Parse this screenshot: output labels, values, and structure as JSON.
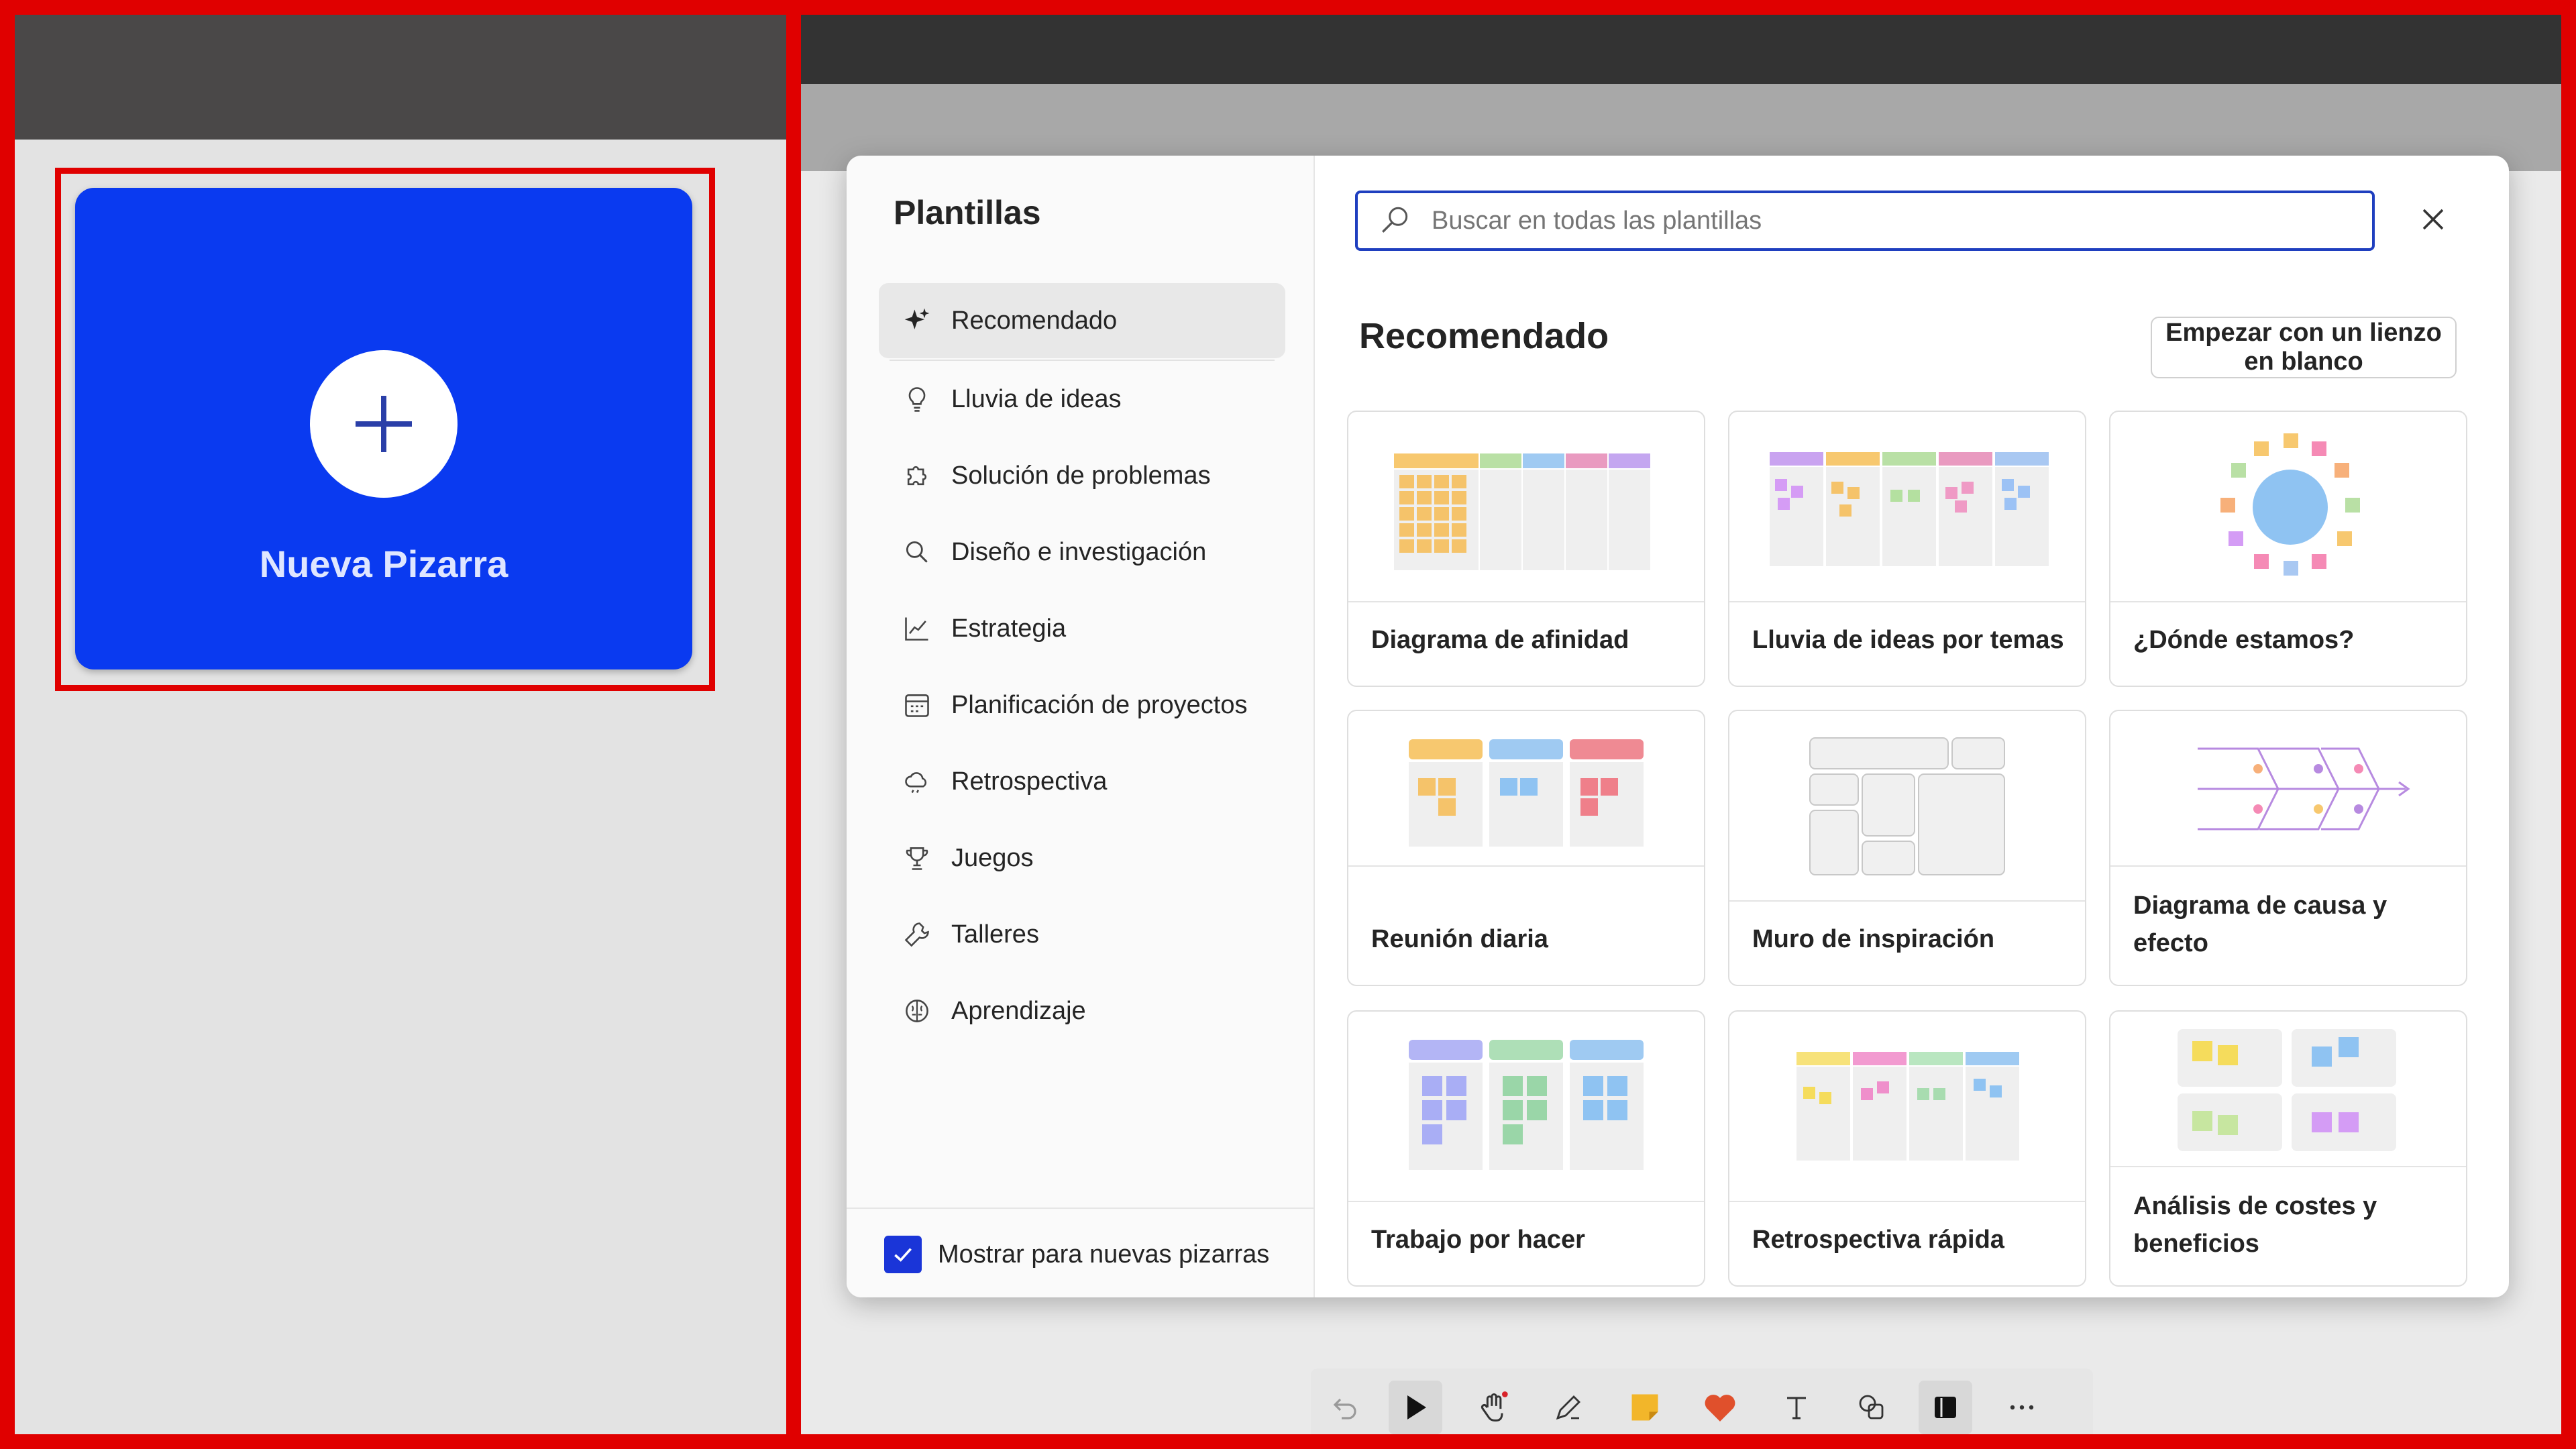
{
  "left": {
    "new_board_label": "Nueva Pizarra"
  },
  "dialog": {
    "title": "Plantillas",
    "search_placeholder": "Buscar en todas las plantillas",
    "section_title": "Recomendado",
    "blank_button": "Empezar con un lienzo en blanco",
    "show_checkbox_label": "Mostrar para nuevas pizarras",
    "nav": [
      {
        "label": "Recomendado",
        "icon": "sparkle-icon",
        "active": true
      },
      {
        "label": "Lluvia de ideas",
        "icon": "lightbulb-icon"
      },
      {
        "label": "Solución de problemas",
        "icon": "puzzle-icon"
      },
      {
        "label": "Diseño e investigación",
        "icon": "search-icon"
      },
      {
        "label": "Estrategia",
        "icon": "chart-line-icon"
      },
      {
        "label": "Planificación de proyectos",
        "icon": "calendar-icon"
      },
      {
        "label": "Retrospectiva",
        "icon": "cloud-icon"
      },
      {
        "label": "Juegos",
        "icon": "trophy-icon"
      },
      {
        "label": "Talleres",
        "icon": "wrench-icon"
      },
      {
        "label": "Aprendizaje",
        "icon": "brain-icon"
      }
    ],
    "templates": [
      {
        "label": "Diagrama de afinidad"
      },
      {
        "label": "Lluvia de ideas por temas"
      },
      {
        "label": "¿Dónde estamos?"
      },
      {
        "label": "Reunión diaria"
      },
      {
        "label": "Muro de inspiración"
      },
      {
        "label": "Diagrama de causa y efecto"
      },
      {
        "label": "Trabajo por hacer"
      },
      {
        "label": "Retrospectiva rápida"
      },
      {
        "label": "Análisis de costes y beneficios"
      }
    ]
  },
  "toolbar": {
    "tools": [
      "undo-icon",
      "select-pointer-icon",
      "hand-icon",
      "pen-icon",
      "sticky-note-icon",
      "heart-icon",
      "text-icon",
      "shapes-icon",
      "template-icon",
      "more-icon"
    ],
    "accent": "#1a35d8"
  }
}
